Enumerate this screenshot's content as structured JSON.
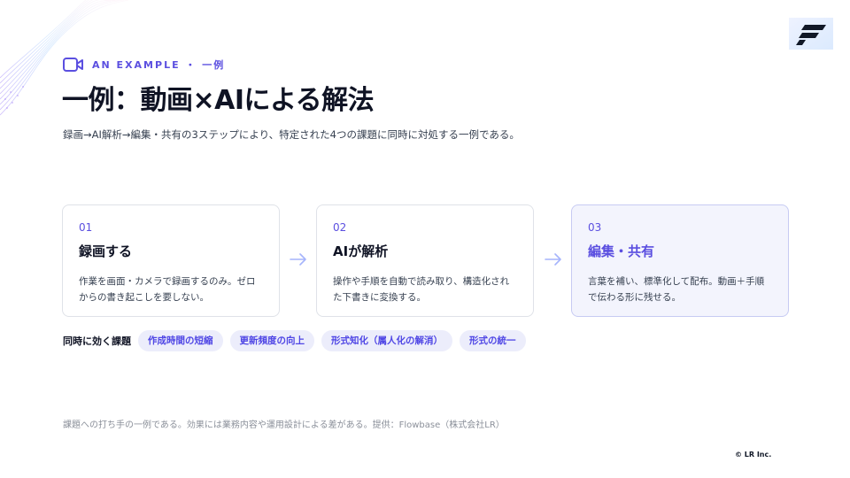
{
  "decor": {
    "corner_deco_icon": "wave-lines-decoration",
    "brand_logo_icon": "brand-f-logo"
  },
  "header": {
    "eyebrow_icon": "video-camera-icon",
    "eyebrow": "AN EXAMPLE ・ 一例",
    "title": "一例：動画×AIによる解法",
    "subtitle": "録画→AI解析→編集・共有の3ステップにより、特定された4つの課題に同時に対処する一例である。"
  },
  "steps": [
    {
      "number": "01",
      "title": "録画する",
      "description": "作業を画面・カメラで録画するのみ。ゼロからの書き起こしを要しない。"
    },
    {
      "number": "02",
      "title": "AIが解析",
      "description": "操作や手順を自動で読み取り、構造化された下書きに変換する。"
    },
    {
      "number": "03",
      "title": "編集・共有",
      "description": "言葉を補い、標準化して配布。動画＋手順で伝わる形に残せる。"
    }
  ],
  "arrow_icon": "right-arrow-icon",
  "challenges": {
    "label": "同時に効く課題",
    "chips": [
      "作成時間の短縮",
      "更新頻度の向上",
      "形式知化（属人化の解消）",
      "形式の統一"
    ]
  },
  "footer": {
    "note": "課題への打ち手の一例である。効果には業務内容や運用設計による差がある。提供：Flowbase（株式会社LR）",
    "copyright": "© LR Inc."
  },
  "colors": {
    "accent": "#5b4fe0",
    "chip_bg": "#ecedfb",
    "highlight_card_bg": "#f3f4fd",
    "card_border": "#dfe2e8",
    "arrow": "#a5b4fc"
  }
}
